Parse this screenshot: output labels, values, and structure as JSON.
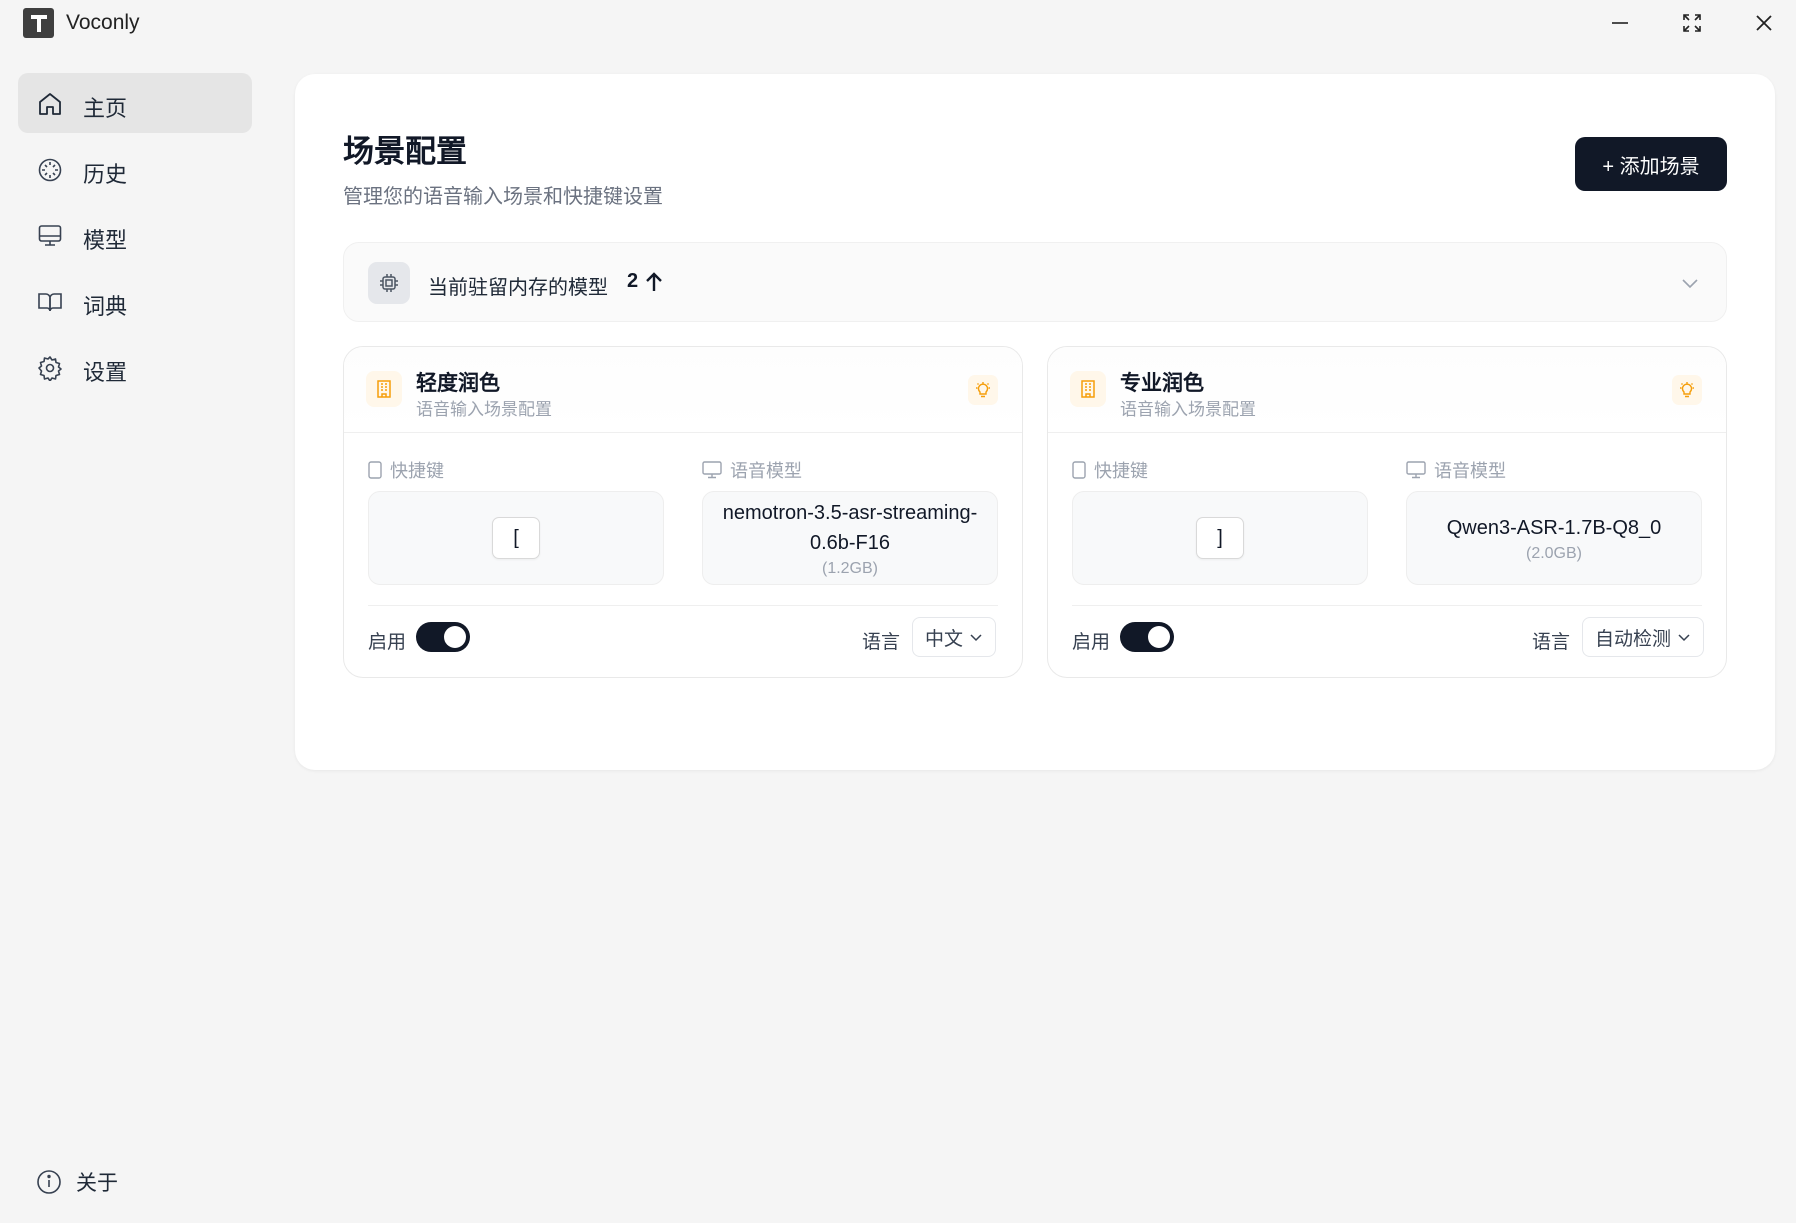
{
  "app": {
    "title": "Voconly"
  },
  "sidebar": {
    "items": [
      {
        "label": "主页",
        "icon": "home-icon"
      },
      {
        "label": "历史",
        "icon": "history-icon"
      },
      {
        "label": "模型",
        "icon": "monitor-icon"
      },
      {
        "label": "词典",
        "icon": "book-icon"
      },
      {
        "label": "设置",
        "icon": "gear-icon"
      }
    ],
    "about": "关于"
  },
  "main": {
    "title": "场景配置",
    "subtitle": "管理您的语音输入场景和快捷键设置",
    "add_button": "+ 添加场景",
    "memory": {
      "label": "当前驻留内存的模型",
      "count": "2"
    },
    "scenes": [
      {
        "name": "轻度润色",
        "desc": "语音输入场景配置",
        "hotkey_label": "快捷键",
        "hotkey": "[",
        "model_label": "语音模型",
        "model_name": "nemotron-3.5-asr-streaming-0.6b-F16",
        "model_size": "(1.2GB)",
        "enable_label": "启用",
        "enabled": true,
        "lang_label": "语言",
        "lang_value": "中文"
      },
      {
        "name": "专业润色",
        "desc": "语音输入场景配置",
        "hotkey_label": "快捷键",
        "hotkey": "]",
        "model_label": "语音模型",
        "model_name": "Qwen3-ASR-1.7B-Q8_0",
        "model_size": "(2.0GB)",
        "enable_label": "启用",
        "enabled": true,
        "lang_label": "语言",
        "lang_value": "自动检测"
      }
    ]
  },
  "colors": {
    "accent": "#111827",
    "scene_icon": "#f59e0b",
    "background": "#f5f5f5"
  }
}
